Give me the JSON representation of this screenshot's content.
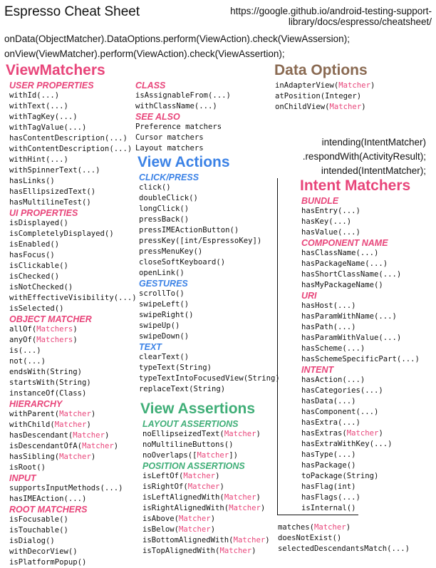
{
  "header": {
    "title": "Espresso Cheat Sheet",
    "url_line1": "https://google.github.io/android-testing-support-",
    "url_line2": "library/docs/espresso/cheatsheet/",
    "flow1": "onData(ObjectMatcher).DataOptions.perform(ViewAction).check(ViewAssersion);",
    "flow2": "onView(ViewMatcher).perform(ViewAction).check(ViewAssertion);"
  },
  "colors": {
    "pink": "#e8457a",
    "blue": "#3b82e6",
    "green": "#3fae77",
    "brown": "#8a6a52"
  },
  "view_matchers": {
    "title": "ViewMatchers",
    "sections": [
      {
        "heading": "USER PROPERTIES",
        "items": [
          {
            "t": "withId(...)"
          },
          {
            "t": "withText(...)"
          },
          {
            "t": "withTagKey(...)"
          },
          {
            "t": "withTagValue(...)"
          },
          {
            "t": "hasContentDescription(...)"
          },
          {
            "t": "withContentDescription(...)"
          },
          {
            "t": "withHint(...)"
          },
          {
            "t": "withSpinnerText(...)"
          },
          {
            "t": "hasLinks()"
          },
          {
            "t": "hasEllipsizedText()"
          },
          {
            "t": "hasMultilineTest()"
          }
        ]
      },
      {
        "heading": "UI PROPERTIES",
        "items": [
          {
            "t": "isDisplayed()"
          },
          {
            "t": "isCompletelyDisplayed()"
          },
          {
            "t": "isEnabled()"
          },
          {
            "t": "hasFocus()"
          },
          {
            "t": "isClickable()"
          },
          {
            "t": "isChecked()"
          },
          {
            "t": "isNotChecked()"
          },
          {
            "t": "withEffectiveVisibility(...)"
          },
          {
            "t": "isSelected()"
          }
        ]
      },
      {
        "heading": "OBJECT MATCHER",
        "items": [
          {
            "t": "allOf(",
            "a": "Matchers",
            "e": ")"
          },
          {
            "t": "anyOf(",
            "a": "Matchers",
            "e": ")"
          },
          {
            "t": "is(...)"
          },
          {
            "t": "not(...)"
          },
          {
            "t": "endsWith(String)"
          },
          {
            "t": "startsWith(String)"
          },
          {
            "t": "instanceOf(Class)"
          }
        ]
      },
      {
        "heading": "HIERARCHY",
        "items": [
          {
            "t": "withParent(",
            "a": "Matcher",
            "e": ")"
          },
          {
            "t": "withChild(",
            "a": "Matcher",
            "e": ")"
          },
          {
            "t": "hasDescendant(",
            "a": "Matcher",
            "e": ")"
          },
          {
            "t": "isDescendantOfA(",
            "a": "Matcher",
            "e": ")"
          },
          {
            "t": "hasSibling(",
            "a": "Matcher",
            "e": ")"
          },
          {
            "t": "isRoot()"
          }
        ]
      },
      {
        "heading": "INPUT",
        "items": [
          {
            "t": "supportsInputMethods(...)"
          },
          {
            "t": "hasIMEAction(...)"
          }
        ]
      },
      {
        "heading": "ROOT MATCHERS",
        "items": [
          {
            "t": "isFocusable()"
          },
          {
            "t": "isTouchable()"
          },
          {
            "t": "isDialog()"
          },
          {
            "t": "withDecorView()"
          },
          {
            "t": "isPlatformPopup()"
          }
        ]
      }
    ]
  },
  "col2_top": {
    "sections": [
      {
        "heading": "CLASS",
        "items": [
          {
            "t": "isAssignableFrom(...)"
          },
          {
            "t": "withClassName(...)"
          }
        ]
      },
      {
        "heading": "SEE ALSO",
        "items": [
          {
            "t": "Preference matchers"
          },
          {
            "t": "Cursor matchers"
          },
          {
            "t": "Layout matchers"
          }
        ]
      }
    ]
  },
  "view_actions": {
    "title": "View Actions",
    "sections": [
      {
        "heading": "CLICK/PRESS",
        "items": [
          {
            "t": "click()"
          },
          {
            "t": "doubleClick()"
          },
          {
            "t": "longClick()"
          },
          {
            "t": "pressBack()"
          },
          {
            "t": "pressIMEActionButton()"
          },
          {
            "t": "pressKey([int/EspressoKey])"
          },
          {
            "t": "pressMenuKey()"
          },
          {
            "t": "closeSoftKeyboard()"
          },
          {
            "t": "openLink()"
          }
        ]
      },
      {
        "heading": "GESTURES",
        "items": [
          {
            "t": "scrollTo()"
          },
          {
            "t": "swipeLeft()"
          },
          {
            "t": "swipeRight()"
          },
          {
            "t": "swipeUp()"
          },
          {
            "t": "swipeDown()"
          }
        ]
      },
      {
        "heading": "TEXT",
        "items": [
          {
            "t": "clearText()"
          },
          {
            "t": "typeText(String)"
          },
          {
            "t": "typeTextIntoFocusedView(String)"
          },
          {
            "t": "replaceText(String)"
          }
        ]
      }
    ]
  },
  "view_assertions": {
    "title": "View Assertions",
    "sections": [
      {
        "heading": "LAYOUT ASSERTIONS",
        "items": [
          {
            "t": "noEllipseizedText(",
            "a": "Matcher",
            "e": ")"
          },
          {
            "t": "noMultilineButtons()"
          },
          {
            "t": "noOverlaps([",
            "a": "Matcher",
            "e": "])"
          }
        ]
      },
      {
        "heading": "POSITION ASSERTIONS",
        "items": [
          {
            "t": "isLeftOf(",
            "a": "Matcher",
            "e": ")"
          },
          {
            "t": "isRightOf(",
            "a": "Matcher",
            "e": ")"
          },
          {
            "t": "isLeftAlignedWith(",
            "a": "Matcher",
            "e": ")"
          },
          {
            "t": "isRightAlignedWith(",
            "a": "Matcher",
            "e": ")"
          },
          {
            "t": "isAbove(",
            "a": "Matcher",
            "e": ")"
          },
          {
            "t": "isBelow(",
            "a": "Matcher",
            "e": ")"
          },
          {
            "t": "isBottomAlignedWith(",
            "a": "Matcher",
            "e": ")"
          },
          {
            "t": "isTopAlignedWith(",
            "a": "Matcher",
            "e": ")"
          }
        ]
      }
    ]
  },
  "data_options": {
    "title": "Data Options",
    "items": [
      {
        "t": "inAdapterView(",
        "a": "Matcher",
        "e": ")"
      },
      {
        "t": "atPosition(Integer)"
      },
      {
        "t": "onChildView(",
        "a": "Matcher",
        "e": ")"
      }
    ]
  },
  "intending": {
    "line1": "intending(IntentMatcher)",
    "line2": ".respondWith(ActivityResult);",
    "line3": "intended(IntentMatcher);"
  },
  "intent_matchers": {
    "title": "Intent Matchers",
    "sections": [
      {
        "heading": "BUNDLE",
        "items": [
          {
            "t": "hasEntry(...)"
          },
          {
            "t": "hasKey(...)"
          },
          {
            "t": "hasValue(...)"
          }
        ]
      },
      {
        "heading": "COMPONENT NAME",
        "items": [
          {
            "t": "hasClassName(...)"
          },
          {
            "t": "hasPackageName(...)"
          },
          {
            "t": "hasShortClassName(...)"
          },
          {
            "t": "hasMyPackageName()"
          }
        ]
      },
      {
        "heading": "URI",
        "items": [
          {
            "t": "hasHost(...)"
          },
          {
            "t": "hasParamWithName(...)"
          },
          {
            "t": "hasPath(...)"
          },
          {
            "t": "hasParamWithValue(...)"
          },
          {
            "t": "hasScheme(...)"
          },
          {
            "t": "hasSchemeSpecificPart(...)"
          }
        ]
      },
      {
        "heading": "INTENT",
        "items": [
          {
            "t": "hasAction(...)"
          },
          {
            "t": "hasCategories(...)"
          },
          {
            "t": "hasData(...)"
          },
          {
            "t": "hasComponent(...)"
          },
          {
            "t": "hasExtra(...)"
          },
          {
            "t": "hasExtras(",
            "a": "Matcher",
            "e": ")"
          },
          {
            "t": "hasExtraWithKey(...)"
          },
          {
            "t": "hasType(...)"
          },
          {
            "t": "hasPackage()"
          },
          {
            "t": "toPackage(String)"
          },
          {
            "t": "hasFlag(int)"
          },
          {
            "t": "hasFlags(...)"
          },
          {
            "t": "isInternal()"
          }
        ]
      }
    ]
  },
  "bottom_matchers": {
    "items": [
      {
        "t": "matches(",
        "a": "Matcher",
        "e": ")"
      },
      {
        "t": "doesNotExist()"
      },
      {
        "t": "selectedDescendantsMatch(...)"
      }
    ]
  }
}
